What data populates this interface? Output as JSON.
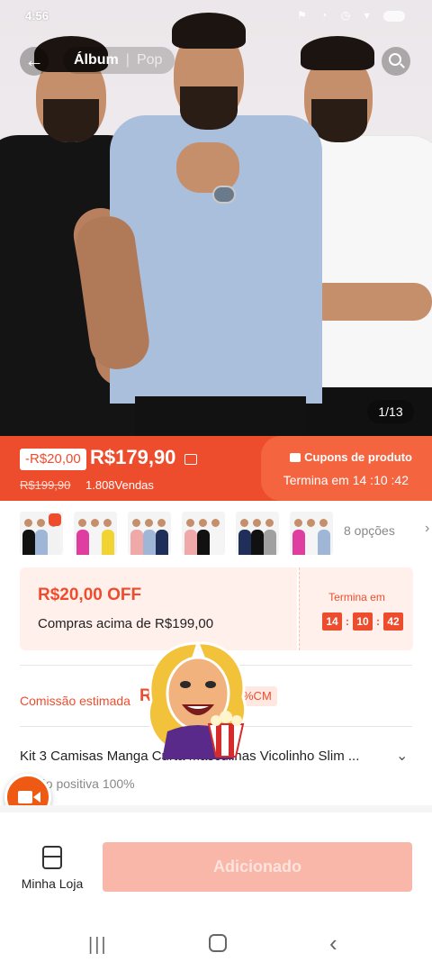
{
  "status": {
    "time": "4:56",
    "icons": "⚑ ◔ ◷ ▾"
  },
  "top": {
    "tab_album": "Álbum",
    "tab_pop": "Pop"
  },
  "gallery": {
    "counter": "1/13"
  },
  "price": {
    "discount_badge": "-R$20,00",
    "current": "R$179,90",
    "original": "R$199,90",
    "sold": "1.808Vendas",
    "coupon_title": "Cupons de produto",
    "countdown": "Termina em 14 :10 :42"
  },
  "variants": {
    "options_label": "8 opções",
    "thumb_count": 6
  },
  "voucher": {
    "amount": "R$20,00 OFF",
    "condition": "Compras acima de R$199,00",
    "ends_label": "Termina em",
    "hours": "14",
    "minutes": "10",
    "seconds": "42"
  },
  "commission": {
    "label": "Comissão estimada",
    "value": "R",
    "pill": "%CM"
  },
  "product": {
    "title": "Kit 3 Camisas Manga Curta Masculinas Vicolinho Slim ...",
    "rating": "liação positiva 100%"
  },
  "bottom": {
    "store_label": "Minha Loja",
    "add_label": "Adicionado"
  },
  "colors": {
    "accent": "#ee4d2d",
    "add_disabled": "#f8b7a9"
  },
  "icons": [
    "back-arrow-icon",
    "search-icon",
    "coupon-icon",
    "camera-icon",
    "store-icon",
    "chevron-right-icon",
    "chevron-down-icon"
  ]
}
